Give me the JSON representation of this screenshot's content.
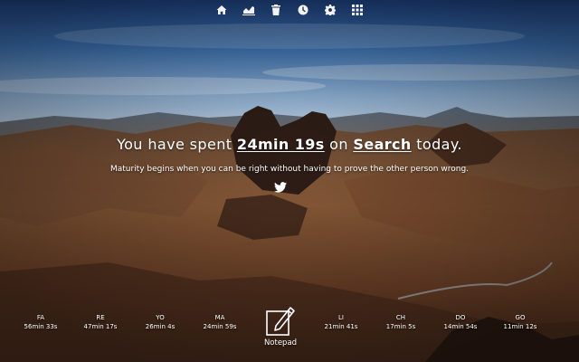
{
  "toolbar": {
    "icons": [
      "home-icon",
      "chart-icon",
      "trash-icon",
      "clock-icon",
      "gear-icon",
      "grid-icon"
    ]
  },
  "headline": {
    "prefix": "You have spent ",
    "time": "24min 19s",
    "middle": " on ",
    "site": "Search",
    "suffix": " today."
  },
  "quote": "Maturity begins when you can be right without having to prove the other person wrong.",
  "stats": [
    {
      "label": "FA",
      "time": "56min 33s"
    },
    {
      "label": "RE",
      "time": "47min 17s"
    },
    {
      "label": "YO",
      "time": "26min 4s"
    },
    {
      "label": "MA",
      "time": "24min 59s"
    },
    {
      "label": "LI",
      "time": "21min 41s"
    },
    {
      "label": "CH",
      "time": "17min 5s"
    },
    {
      "label": "DO",
      "time": "14min 54s"
    },
    {
      "label": "GO",
      "time": "11min 12s"
    }
  ],
  "notepad": {
    "label": "Notepad"
  }
}
